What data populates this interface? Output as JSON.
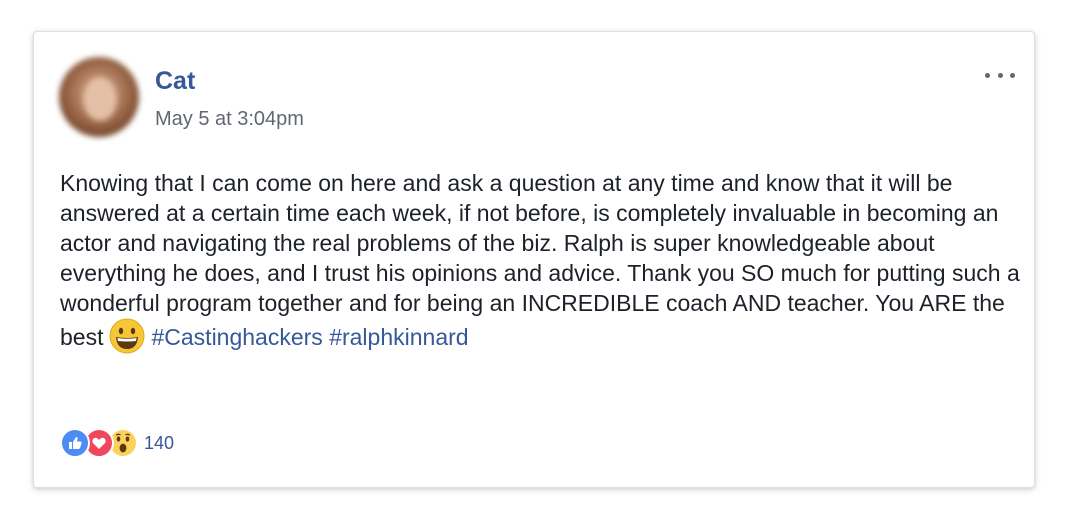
{
  "post": {
    "author": "Cat",
    "timestamp": "May 5 at 3:04pm",
    "text_part1": "Knowing that I can come on here and ask a question at any time and know that it will be answered at a certain time each week, if not before, is completely invaluable in becoming an actor and navigating the real problems of the biz. Ralph is super knowledgeable about everything he does, and I trust his opinions and advice. Thank you SO much for putting such a wonderful program together and for being an INCREDIBLE coach AND teacher. You ARE the best",
    "emoji": "grinning-face",
    "hashtags": [
      "#Castinghackers",
      "#ralphkinnard"
    ]
  },
  "reactions": {
    "icons": [
      "like-icon",
      "love-icon",
      "wow-icon"
    ],
    "count": "140"
  },
  "colors": {
    "link": "#365899",
    "text": "#1d2129",
    "meta": "#616770",
    "like": "#4d8cf5",
    "love": "#f0475e",
    "wow": "#fbd15b"
  }
}
